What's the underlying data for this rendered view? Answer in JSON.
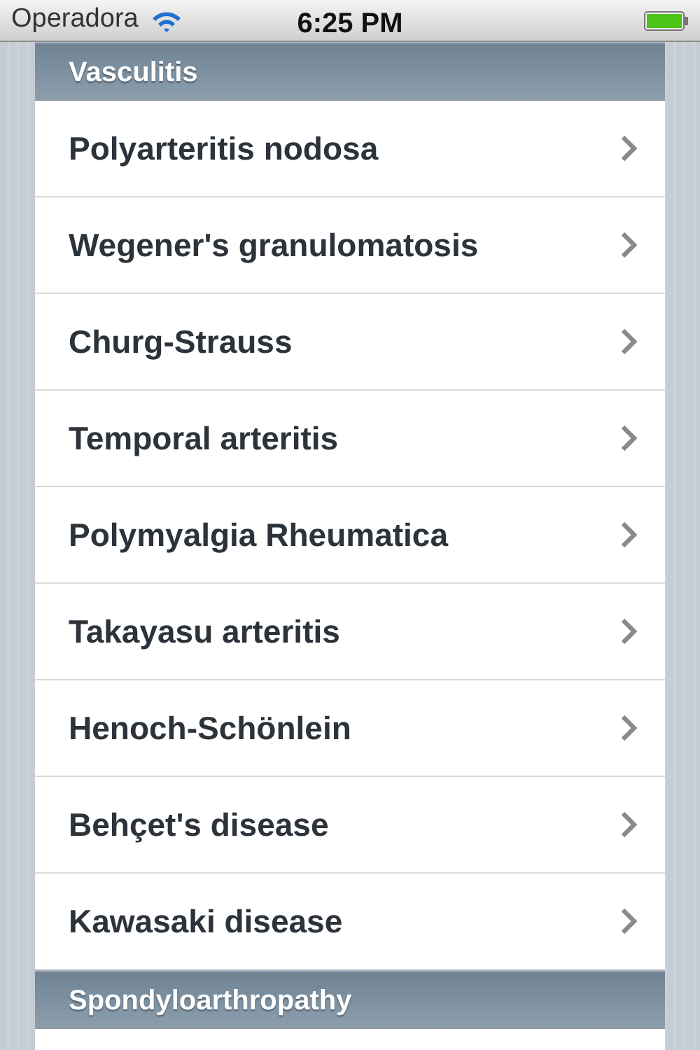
{
  "status_bar": {
    "carrier": "Operadora",
    "time": "6:25 PM"
  },
  "sections": [
    {
      "title": "Vasculitis",
      "items": [
        "Polyarteritis nodosa",
        "Wegener's granulomatosis",
        "Churg-Strauss",
        "Temporal arteritis",
        "Polymyalgia Rheumatica",
        "Takayasu arteritis",
        "Henoch-Schönlein",
        "Behçet's disease",
        "Kawasaki disease"
      ]
    },
    {
      "title": "Spondyloarthropathy"
    }
  ]
}
